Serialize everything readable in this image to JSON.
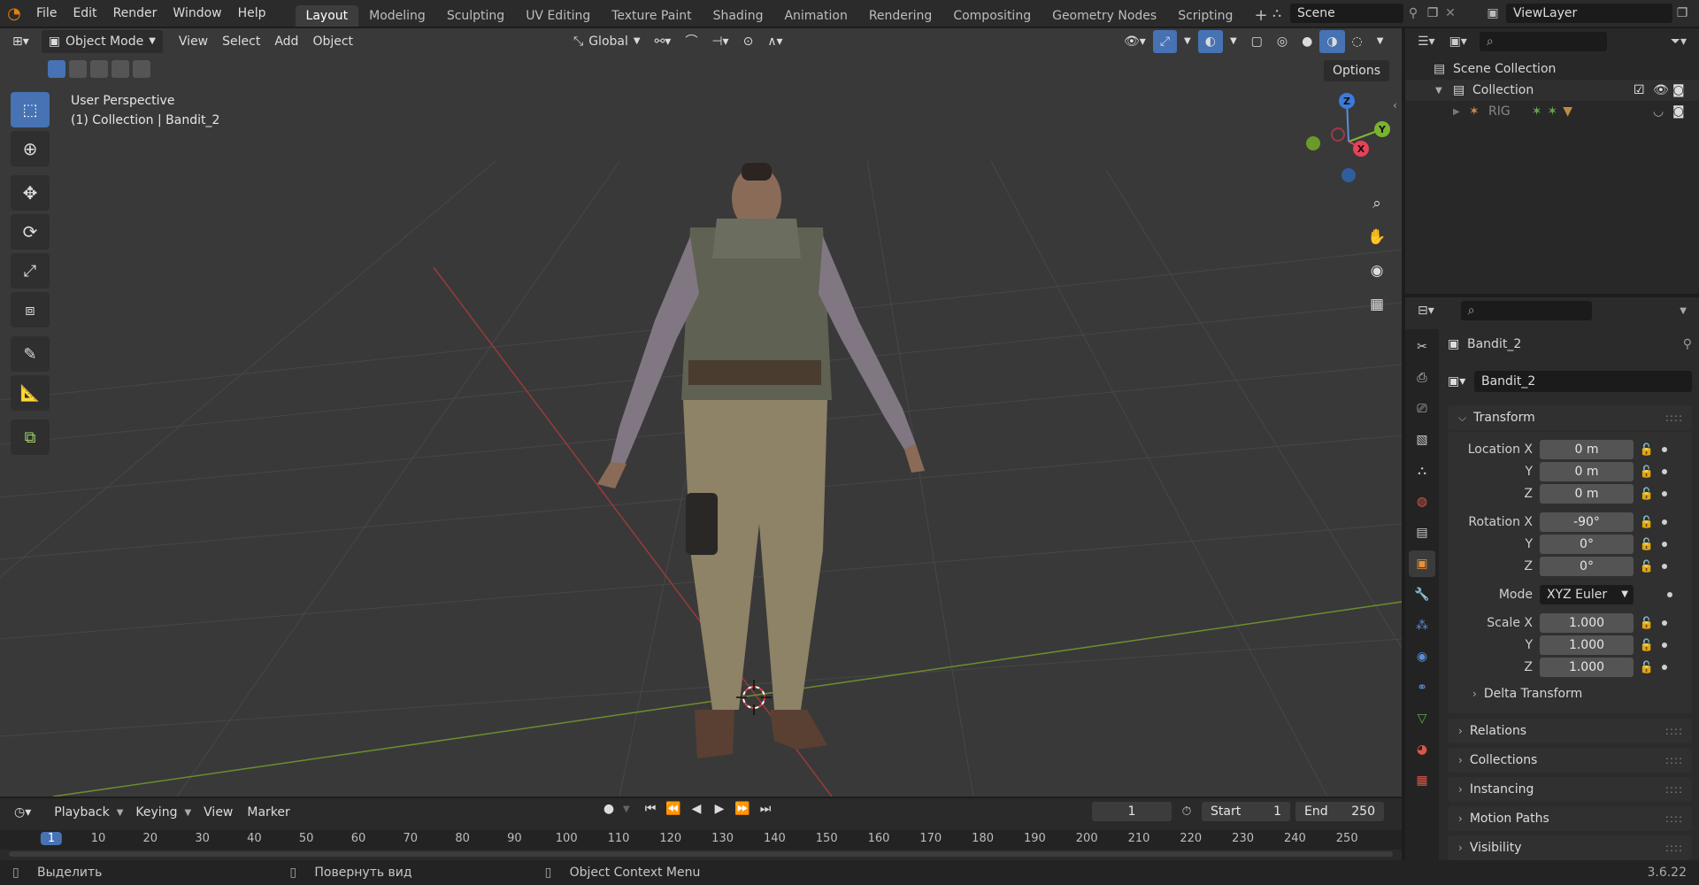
{
  "menu": [
    "File",
    "Edit",
    "Render",
    "Window",
    "Help"
  ],
  "workspaces": [
    "Layout",
    "Modeling",
    "Sculpting",
    "UV Editing",
    "Texture Paint",
    "Shading",
    "Animation",
    "Rendering",
    "Compositing",
    "Geometry Nodes",
    "Scripting"
  ],
  "active_workspace": "Layout",
  "scene": "Scene",
  "view_layer": "ViewLayer",
  "viewport": {
    "mode": "Object Mode",
    "menu": [
      "View",
      "Select",
      "Add",
      "Object"
    ],
    "orientation": "Global",
    "options": "Options",
    "overlay_title": "User Perspective",
    "overlay_sub": "(1) Collection | Bandit_2",
    "gizmo": {
      "z": "Z",
      "y": "Y",
      "x": "X"
    }
  },
  "outliner": {
    "scene_collection": "Scene Collection",
    "collection": "Collection",
    "rig": "RIG"
  },
  "properties": {
    "object_name": "Bandit_2",
    "data_name": "Bandit_2",
    "transform_title": "Transform",
    "location_label": "Location X",
    "rotation_label": "Rotation X",
    "scale_label": "Scale X",
    "y": "Y",
    "z": "Z",
    "location": [
      "0 m",
      "0 m",
      "0 m"
    ],
    "rotation": [
      "-90°",
      "0°",
      "0°"
    ],
    "mode_label": "Mode",
    "mode_value": "XYZ Euler",
    "scale": [
      "1.000",
      "1.000",
      "1.000"
    ],
    "delta": "Delta Transform",
    "sections": [
      "Relations",
      "Collections",
      "Instancing",
      "Motion Paths",
      "Visibility"
    ]
  },
  "timeline": {
    "menu": [
      "Playback",
      "Keying",
      "View",
      "Marker"
    ],
    "current_frame": "1",
    "start_label": "Start",
    "start": "1",
    "end_label": "End",
    "end": "250",
    "ticks": [
      "1",
      "10",
      "20",
      "30",
      "40",
      "50",
      "60",
      "70",
      "80",
      "90",
      "100",
      "110",
      "120",
      "130",
      "140",
      "150",
      "160",
      "170",
      "180",
      "190",
      "200",
      "210",
      "220",
      "230",
      "240",
      "250"
    ]
  },
  "status": {
    "select": "Выделить",
    "rotate": "Повернуть вид",
    "context": "Object Context Menu",
    "version": "3.6.22"
  }
}
